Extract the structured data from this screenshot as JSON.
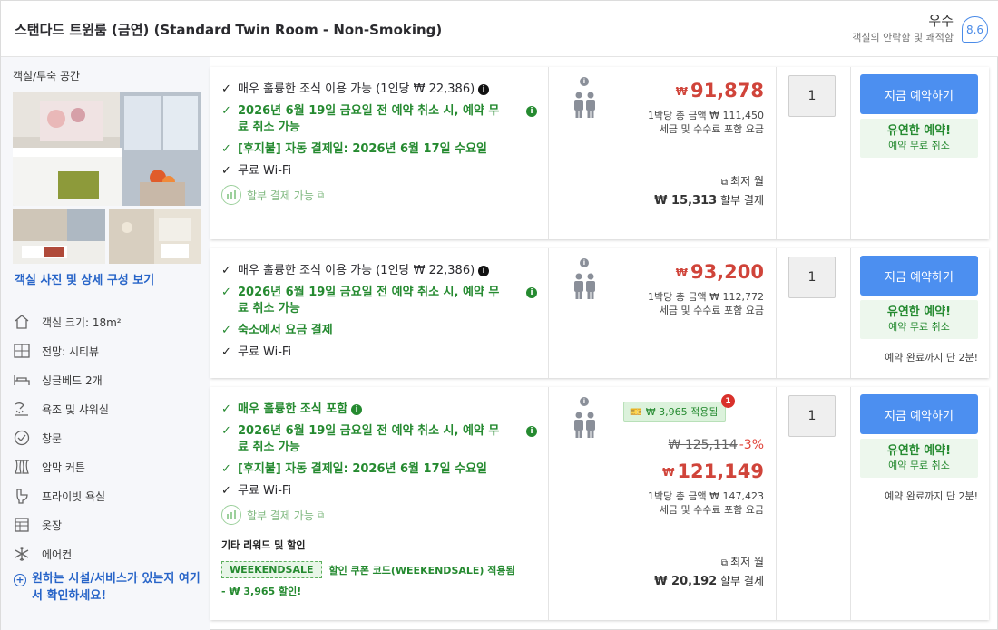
{
  "header": {
    "title": "스탠다드 트윈룸 (금연) (Standard Twin Room - Non-Smoking)",
    "rating_label": "우수",
    "rating_sub": "객실의 안락함 및 쾌적함",
    "score": "8.6"
  },
  "left_panel": {
    "title": "객실/투숙 공간",
    "photo_link": "객실 사진 및 상세 구성 보기",
    "amenities": [
      {
        "icon": "room-size-icon",
        "label": "객실 크기: 18m²"
      },
      {
        "icon": "view-icon",
        "label": "전망: 시티뷰"
      },
      {
        "icon": "bed-icon",
        "label": "싱글베드 2개"
      },
      {
        "icon": "shower-icon",
        "label": "욕조 및 샤워실"
      },
      {
        "icon": "window-icon",
        "label": "창문"
      },
      {
        "icon": "curtain-icon",
        "label": "암막 커튼"
      },
      {
        "icon": "toilet-icon",
        "label": "프라이빗 욕실"
      },
      {
        "icon": "closet-icon",
        "label": "옷장"
      },
      {
        "icon": "snowflake-icon",
        "label": "에어컨"
      }
    ],
    "more_link": "원하는 시설/서비스가 있는지 여기서 확인하세요!"
  },
  "rows": [
    {
      "features": [
        {
          "text": "매우 훌륭한 조식 이용 가능 (1인당 ₩ 22,386)",
          "style": "black",
          "info": "inline"
        },
        {
          "text": "2026년 6월 19일 금요일 전 예약 취소 시, 예약 무료 취소 가능",
          "style": "green",
          "info": "side"
        },
        {
          "text": "[후지불] 자동 결제일: 2026년 6월 17일 수요일",
          "style": "green",
          "info": "none"
        },
        {
          "text": "무료 Wi-Fi",
          "style": "black",
          "info": "none"
        }
      ],
      "installment": "할부 결제 가능",
      "price": {
        "currency": "₩",
        "amount": "91,878",
        "per_night": "1박당 총 금액 ₩ 111,450",
        "tax": "세금 및 수수료 포함 요금",
        "monthly_label": "최저 월",
        "monthly_amount": "₩ 15,313",
        "monthly_suffix": "할부 결제"
      },
      "qty": "1",
      "book": "지금 예약하기",
      "flex_title": "유연한 예약!",
      "flex_sub": "예약 무료 취소",
      "urgency": ""
    },
    {
      "features": [
        {
          "text": "매우 훌륭한 조식 이용 가능 (1인당 ₩ 22,386)",
          "style": "black",
          "info": "inline"
        },
        {
          "text": "2026년 6월 19일 금요일 전 예약 취소 시, 예약 무료 취소 가능",
          "style": "green",
          "info": "side"
        },
        {
          "text": "숙소에서 요금 결제",
          "style": "green",
          "info": "none"
        },
        {
          "text": "무료 Wi-Fi",
          "style": "black",
          "info": "none"
        }
      ],
      "price": {
        "currency": "₩",
        "amount": "93,200",
        "per_night": "1박당 총 금액 ₩ 112,772",
        "tax": "세금 및 수수료 포함 요금"
      },
      "qty": "1",
      "book": "지금 예약하기",
      "flex_title": "유연한 예약!",
      "flex_sub": "예약 무료 취소",
      "urgency": "예약 완료까지 단 2분!"
    },
    {
      "features": [
        {
          "text": "매우 훌륭한 조식 포함",
          "style": "green",
          "info": "inline"
        },
        {
          "text": "2026년 6월 19일 금요일 전 예약 취소 시, 예약 무료 취소 가능",
          "style": "green",
          "info": "side"
        },
        {
          "text": "[후지불] 자동 결제일: 2026년 6월 17일 수요일",
          "style": "green",
          "info": "none"
        },
        {
          "text": "무료 Wi-Fi",
          "style": "black",
          "info": "none"
        }
      ],
      "installment": "할부 결제 가능",
      "other_title": "기타 리워드 및 할인",
      "deal_code": "WEEKENDSALE",
      "deal_text": "할인 쿠폰 코드(WEEKENDSALE) 적용됨",
      "deal_sub": "- ₩ 3,965 할인!",
      "coupon_tag": "₩ 3,965 적용됨",
      "coupon_badge": "1",
      "price": {
        "currency": "₩",
        "old": "₩ 125,114",
        "pct": "-3%",
        "amount": "121,149",
        "per_night": "1박당 총 금액 ₩ 147,423",
        "tax": "세금 및 수수료 포함 요금",
        "monthly_label": "최저 월",
        "monthly_amount": "₩ 20,192",
        "monthly_suffix": "할부 결제"
      },
      "qty": "1",
      "book": "지금 예약하기",
      "flex_title": "유연한 예약!",
      "flex_sub": "예약 무료 취소",
      "urgency": "예약 완료까지 단 2분!"
    }
  ]
}
